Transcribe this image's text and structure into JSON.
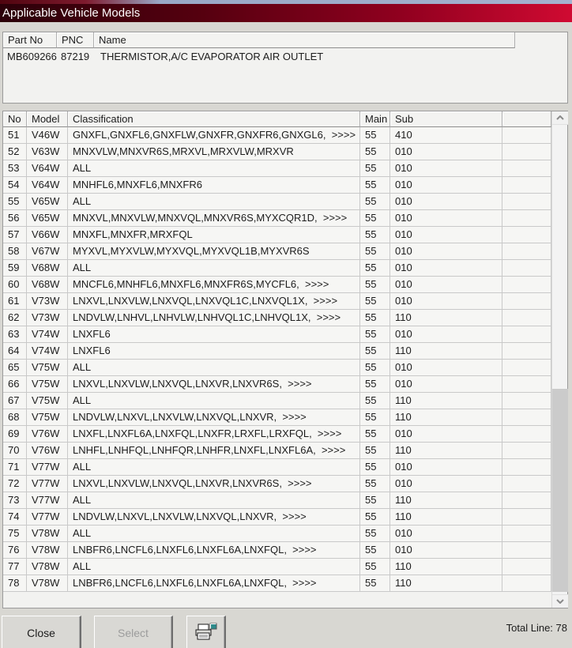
{
  "window": {
    "title": "Applicable Vehicle Models"
  },
  "part_table": {
    "columns": {
      "part_no": "Part No",
      "pnc": "PNC",
      "name": "Name"
    },
    "row": {
      "part_no": "MB609266",
      "pnc": "87219",
      "name": "THERMISTOR,A/C EVAPORATOR AIR OUTLET"
    }
  },
  "main_table": {
    "columns": {
      "no": "No",
      "model": "Model",
      "classification": "Classification",
      "main": "Main",
      "sub": "Sub",
      "blank": ""
    },
    "rows": [
      {
        "no": "51",
        "model": "V46W",
        "classification": "GNXFL,GNXFL6,GNXFLW,GNXFR,GNXFR6,GNXGL6,  >>>>",
        "main": "55",
        "sub": "410"
      },
      {
        "no": "52",
        "model": "V63W",
        "classification": "MNXVLW,MNXVR6S,MRXVL,MRXVLW,MRXVR",
        "main": "55",
        "sub": "010"
      },
      {
        "no": "53",
        "model": "V64W",
        "classification": "ALL",
        "main": "55",
        "sub": "010"
      },
      {
        "no": "54",
        "model": "V64W",
        "classification": "MNHFL6,MNXFL6,MNXFR6",
        "main": "55",
        "sub": "010"
      },
      {
        "no": "55",
        "model": "V65W",
        "classification": "ALL",
        "main": "55",
        "sub": "010"
      },
      {
        "no": "56",
        "model": "V65W",
        "classification": "MNXVL,MNXVLW,MNXVQL,MNXVR6S,MYXCQR1D,  >>>>",
        "main": "55",
        "sub": "010"
      },
      {
        "no": "57",
        "model": "V66W",
        "classification": "MNXFL,MNXFR,MRXFQL",
        "main": "55",
        "sub": "010"
      },
      {
        "no": "58",
        "model": "V67W",
        "classification": "MYXVL,MYXVLW,MYXVQL,MYXVQL1B,MYXVR6S",
        "main": "55",
        "sub": "010"
      },
      {
        "no": "59",
        "model": "V68W",
        "classification": "ALL",
        "main": "55",
        "sub": "010"
      },
      {
        "no": "60",
        "model": "V68W",
        "classification": "MNCFL6,MNHFL6,MNXFL6,MNXFR6S,MYCFL6,  >>>>",
        "main": "55",
        "sub": "010"
      },
      {
        "no": "61",
        "model": "V73W",
        "classification": "LNXVL,LNXVLW,LNXVQL,LNXVQL1C,LNXVQL1X,  >>>>",
        "main": "55",
        "sub": "010"
      },
      {
        "no": "62",
        "model": "V73W",
        "classification": "LNDVLW,LNHVL,LNHVLW,LNHVQL1C,LNHVQL1X,  >>>>",
        "main": "55",
        "sub": "110"
      },
      {
        "no": "63",
        "model": "V74W",
        "classification": "LNXFL6",
        "main": "55",
        "sub": "010"
      },
      {
        "no": "64",
        "model": "V74W",
        "classification": "LNXFL6",
        "main": "55",
        "sub": "110"
      },
      {
        "no": "65",
        "model": "V75W",
        "classification": "ALL",
        "main": "55",
        "sub": "010"
      },
      {
        "no": "66",
        "model": "V75W",
        "classification": "LNXVL,LNXVLW,LNXVQL,LNXVR,LNXVR6S,  >>>>",
        "main": "55",
        "sub": "010"
      },
      {
        "no": "67",
        "model": "V75W",
        "classification": "ALL",
        "main": "55",
        "sub": "110"
      },
      {
        "no": "68",
        "model": "V75W",
        "classification": "LNDVLW,LNXVL,LNXVLW,LNXVQL,LNXVR,  >>>>",
        "main": "55",
        "sub": "110"
      },
      {
        "no": "69",
        "model": "V76W",
        "classification": "LNXFL,LNXFL6A,LNXFQL,LNXFR,LRXFL,LRXFQL,  >>>>",
        "main": "55",
        "sub": "010"
      },
      {
        "no": "70",
        "model": "V76W",
        "classification": "LNHFL,LNHFQL,LNHFQR,LNHFR,LNXFL,LNXFL6A,  >>>>",
        "main": "55",
        "sub": "110"
      },
      {
        "no": "71",
        "model": "V77W",
        "classification": "ALL",
        "main": "55",
        "sub": "010"
      },
      {
        "no": "72",
        "model": "V77W",
        "classification": "LNXVL,LNXVLW,LNXVQL,LNXVR,LNXVR6S,  >>>>",
        "main": "55",
        "sub": "010"
      },
      {
        "no": "73",
        "model": "V77W",
        "classification": "ALL",
        "main": "55",
        "sub": "110"
      },
      {
        "no": "74",
        "model": "V77W",
        "classification": "LNDVLW,LNXVL,LNXVLW,LNXVQL,LNXVR,  >>>>",
        "main": "55",
        "sub": "110"
      },
      {
        "no": "75",
        "model": "V78W",
        "classification": "ALL",
        "main": "55",
        "sub": "010"
      },
      {
        "no": "76",
        "model": "V78W",
        "classification": "LNBFR6,LNCFL6,LNXFL6,LNXFL6A,LNXFQL,  >>>>",
        "main": "55",
        "sub": "010"
      },
      {
        "no": "77",
        "model": "V78W",
        "classification": "ALL",
        "main": "55",
        "sub": "110"
      },
      {
        "no": "78",
        "model": "V78W",
        "classification": "LNBFR6,LNCFL6,LNXFL6,LNXFL6A,LNXFQL,  >>>>",
        "main": "55",
        "sub": "110"
      }
    ]
  },
  "scrollbar": {
    "up_icon": "chevron-up-icon",
    "down_icon": "chevron-down-icon"
  },
  "footer": {
    "close_label": "Close",
    "select_label": "Select",
    "select_disabled": true,
    "printer_icon": "printer-icon",
    "total_line": "Total Line: 78"
  },
  "colors": {
    "title_gradient_left": "#2b0009",
    "title_gradient_right": "#d00a32",
    "top_strip_blue": "#a4b1ce",
    "dialog_bg": "#d8d7d2",
    "table_bg": "#f2f2f0",
    "row_border": "#c9c9c9",
    "disabled_text": "#9c9c9c",
    "printer_accent_teal": "#2e8b8b"
  }
}
